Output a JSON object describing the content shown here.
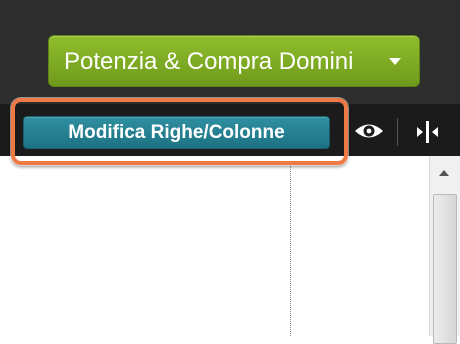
{
  "header": {
    "potenzia_button": {
      "label": "Potenzia & Compra Domini",
      "icon": "caret-down-icon"
    }
  },
  "toolbar": {
    "modifica_button": {
      "label": "Modifica Righe/Colonne"
    },
    "preview_icon": "eye-icon",
    "resize_icon": "resize-horizontal-icon",
    "highlight_color": "#ef7a45"
  },
  "colors": {
    "header_bg": "#2d2d2d",
    "toolbar_bg": "#1b1b1b",
    "potenzia_green": "#7ba922",
    "modifica_teal": "#26808f"
  }
}
